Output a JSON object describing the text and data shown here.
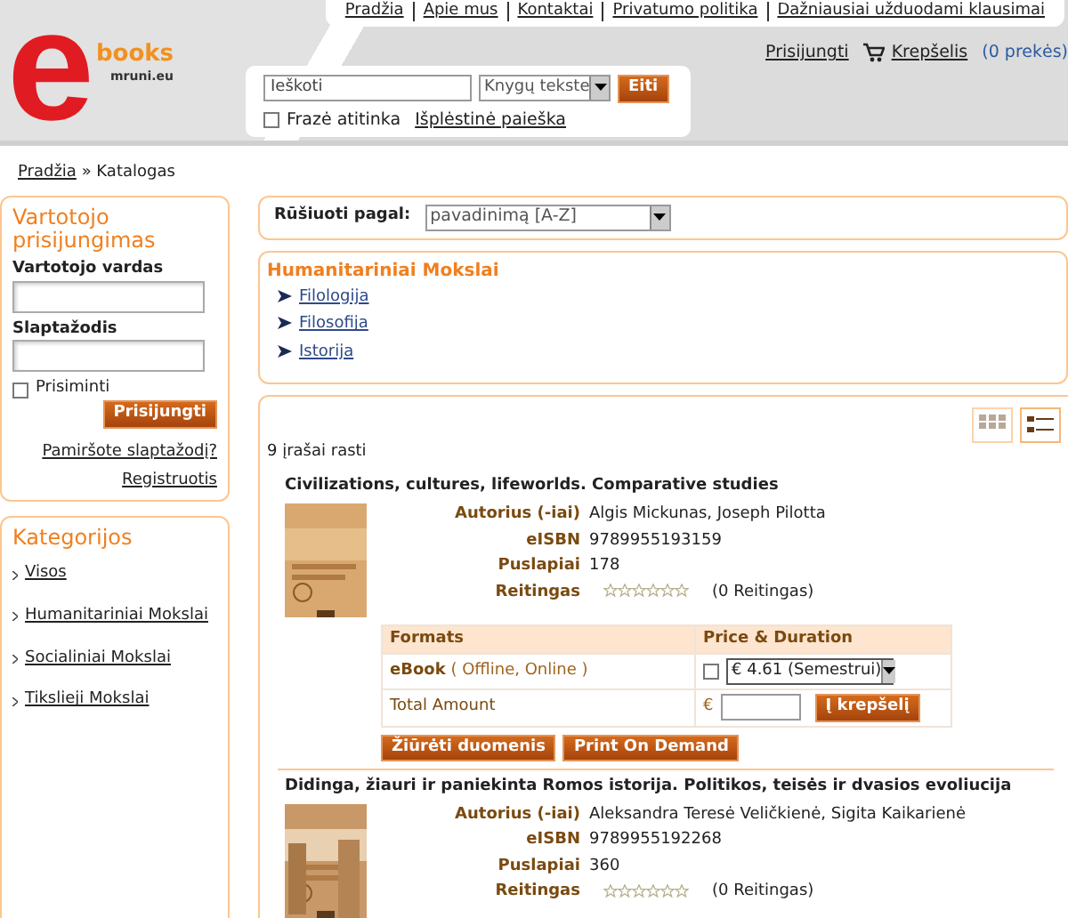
{
  "logo": {
    "mark": "e",
    "name": "books",
    "domain": "mruni.eu"
  },
  "top_nav": [
    "Pradžia",
    "Apie mus",
    "Kontaktai",
    "Privatumo politika",
    "Dažniausiai užduodami klausimai"
  ],
  "user_links": {
    "login": "Prisijungti",
    "cart": "Krepšelis",
    "cart_count": "(0 prekės)"
  },
  "search": {
    "value": "Ieškoti",
    "scope": "Knygų tekste",
    "button": "Eiti",
    "exact_phrase": {
      "label": "Frazė atitinka",
      "checked": false
    },
    "advanced": "Išplėstinė paieška"
  },
  "breadcrumb": [
    {
      "label": "Pradžia",
      "kind": "link"
    },
    {
      "label": "» Katalogas",
      "kind": "text"
    }
  ],
  "login_box": {
    "title": "Vartotojo prisijungimas",
    "username_label": "Vartotojo vardas",
    "password_label": "Slaptažodis",
    "remember": {
      "label": "Prisiminti",
      "checked": false
    },
    "button": "Prisijungti",
    "forgot": "Pamiršote slaptažodį?",
    "register": "Registruotis"
  },
  "categories": {
    "title": "Kategorijos",
    "items": [
      {
        "label": "Visos"
      },
      {
        "label": "Humanitariniai Mokslai"
      },
      {
        "label": "Socialiniai Mokslai"
      },
      {
        "label": "Tikslieji Mokslai"
      }
    ]
  },
  "sort": {
    "label": "Rūšiuoti pagal:",
    "value": "pavadinimą [A-Z]"
  },
  "category_box": {
    "title": "Humanitariniai Mokslai",
    "items": [
      "Filologija",
      "Filosofija",
      "Istorija"
    ]
  },
  "view_toggle": [
    {
      "kind": "grid",
      "selected": false
    },
    {
      "kind": "list",
      "selected": true
    }
  ],
  "results_count": "9 įrašai rasti",
  "products": [
    {
      "title": "Civilizations, cultures, lifeworlds. Comparative studies",
      "fields": [
        {
          "label": "Autorius (-iai)",
          "value": "Algis Mickunas, Joseph Pilotta"
        },
        {
          "label": "eISBN",
          "value": "9789955193159"
        },
        {
          "label": "Puslapiai",
          "value": "178"
        }
      ],
      "rating_label": "Reitingas",
      "stars": 0,
      "rating_count": "(0 Reitingas)",
      "formats": {
        "columns": [
          "Formats",
          "Price & Duration"
        ],
        "format_name": "eBook",
        "format_detail": "( Offline, Online )",
        "selected": false,
        "price": "€ 4.61 (Semestrui)",
        "total_label": "Total Amount",
        "currency": "€",
        "cart_button": "Į krepšelį"
      },
      "buttons": [
        "Žiūrėti duomenis",
        "Print On Demand"
      ]
    },
    {
      "title": "Didinga, žiauri ir paniekinta Romos istorija. Politikos, teisės ir dvasios evoliucija",
      "fields": [
        {
          "label": "Autorius (-iai)",
          "value": "Aleksandra Teresė Veličkienė, Sigita Kaikarienė"
        },
        {
          "label": "eISBN",
          "value": "9789955192268"
        },
        {
          "label": "Puslapiai",
          "value": "360"
        }
      ],
      "rating_label": "Reitingas",
      "stars": 0,
      "rating_count": "(0 Reitingas)"
    }
  ]
}
